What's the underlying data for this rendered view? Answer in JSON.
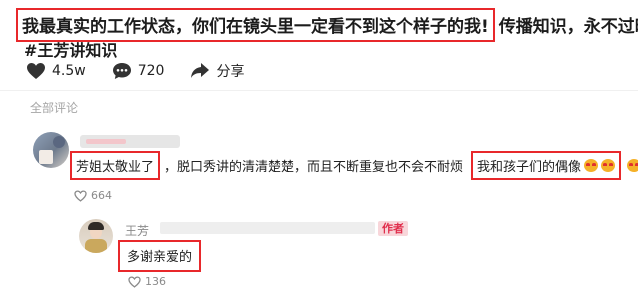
{
  "post": {
    "title_boxed": "我最真实的工作状态，你们在镜头里一定看不到这个样子的我!",
    "title_tail": "传播知识，永不过时!",
    "hashtag": "#王芳讲知识",
    "stats": {
      "likes": "4.5w",
      "comments": "720",
      "share_label": "分享"
    }
  },
  "section_label": "全部评论",
  "comment1": {
    "text_boxed_a": "芳姐太敬业了",
    "text_middle": "，脱口秀讲的清清楚楚，而且不断重复也不会不耐烦",
    "text_boxed_b": "我和孩子们的偶像",
    "likes": "664"
  },
  "reply": {
    "name_visible": "王芳",
    "author_badge": "作者",
    "text": "多谢亲爱的",
    "likes": "136"
  },
  "icons": [
    "heart-icon",
    "comment-icon",
    "share-icon",
    "emoji-icon"
  ],
  "colors": {
    "highlight_box": "#e8282b",
    "author_badge_bg": "#f8d6da",
    "author_badge_text": "#e02e4c",
    "muted": "#8a8a8a"
  }
}
